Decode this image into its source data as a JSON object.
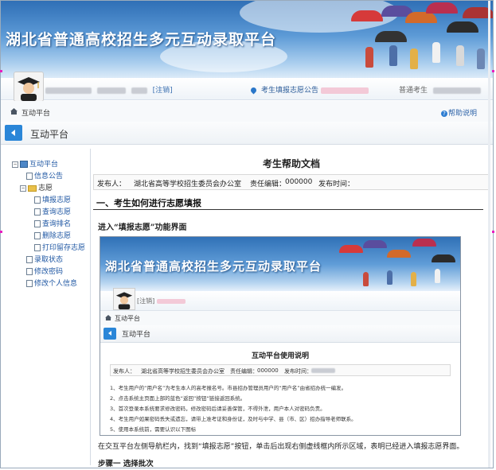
{
  "banner": {
    "title": "湖北省普通高校招生多元互动录取平台"
  },
  "userbar": {
    "user_info_blurred": "",
    "logout_label": "[注销]",
    "notice_label": "考生填报志愿公告",
    "right_label": "普通考生"
  },
  "crumb": {
    "label": "互动平台",
    "help_label": "帮助说明"
  },
  "platform": {
    "title": "互动平台"
  },
  "sidebar": {
    "items": [
      {
        "label": "互动平台"
      },
      {
        "label": "信息公告"
      },
      {
        "label": "志愿"
      },
      {
        "label": "填报志愿"
      },
      {
        "label": "查询志愿"
      },
      {
        "label": "查询排名"
      },
      {
        "label": "删除志愿"
      },
      {
        "label": "打印留存志愿"
      },
      {
        "label": "录取状态"
      },
      {
        "label": "修改密码"
      },
      {
        "label": "修改个人信息"
      }
    ]
  },
  "doc": {
    "title": "考生帮助文档",
    "publisher_label": "发布人：",
    "publisher_value": "湖北省高等学校招生委员会办公室",
    "editor_label": "责任编辑：",
    "editor_value": "000000",
    "time_label": "发布时间：",
    "section1": "一、考生如何进行志愿填报",
    "subhead": "进入“填报志愿”功能界面",
    "paragraph": "在交互平台左侧导航栏内，找到“填报志愿”按钮，单击后出现右侧虚线框内所示区域，表明已经进入填报志愿界面。",
    "step1": "步骤一   选择批次"
  },
  "shot": {
    "title": "湖北省普通高校招生多元互动录取平台",
    "user": "[注销]",
    "crumb": "互动平台",
    "platform": "互动平台",
    "doc_title": "互动平台使用说明",
    "publisher_label": "发布人：",
    "publisher_value": "湖北省高等学校招生委员会办公室",
    "editor_label": "责任编辑：",
    "editor_value": "000000",
    "time_label": "发布时间：",
    "lines": [
      "1、考生用户的“用户名”为考生本人的高考报名号。市县招办管理员用户的“用户名”由省招办统一编发。",
      "2、点击系统主页面上部的蓝色“返回”按钮“链接返回系统。",
      "3、首次登录本系统要求修改密码，修改密码后请妥善保管，不得外泄，用户本人对密码负责。",
      "4、考生用户如果密码丢失或遗忘，请带上准考证和身份证，及时与中学、县（市、区）招办指导老师联系。",
      "5、使用本系统前，需要认识以下图标"
    ]
  },
  "colors": {
    "accent": "#2a86d8",
    "link": "#1f57a3"
  }
}
